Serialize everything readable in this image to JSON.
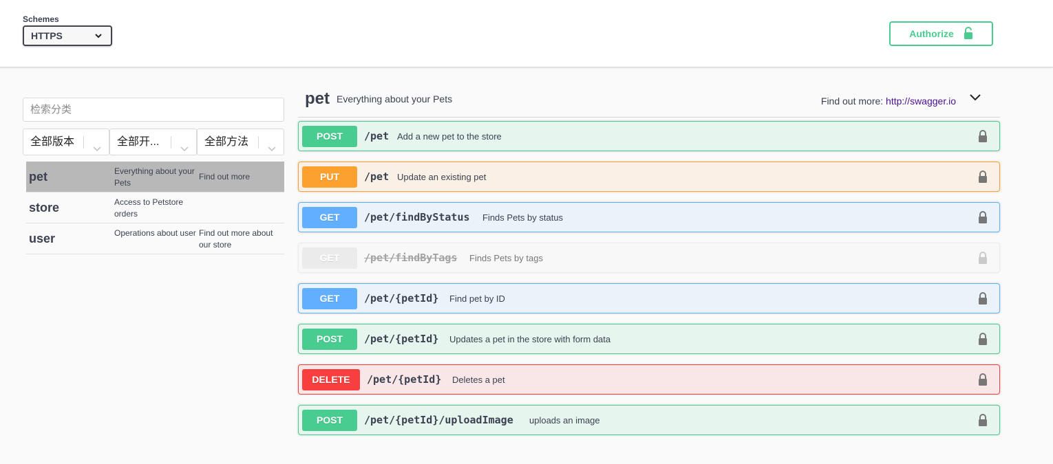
{
  "topbar": {
    "schemes_label": "Schemes",
    "scheme_value": "HTTPS",
    "authorize_label": "Authorize"
  },
  "sidebar": {
    "search_placeholder": "检索分类",
    "filters": [
      {
        "label": "全部版本"
      },
      {
        "label": "全部开..."
      },
      {
        "label": "全部方法"
      }
    ],
    "tags": [
      {
        "name": "pet",
        "description": "Everything about your Pets",
        "more": "Find out more",
        "active": true
      },
      {
        "name": "store",
        "description": "Access to Petstore orders",
        "more": "",
        "active": false
      },
      {
        "name": "user",
        "description": "Operations about user",
        "more": "Find out more about our store",
        "active": false
      }
    ]
  },
  "section": {
    "title": "pet",
    "description": "Everything about your Pets",
    "more_label": "Find out more:",
    "more_link": "http://swagger.io"
  },
  "operations": [
    {
      "method": "POST",
      "path": "/pet",
      "summary": "Add a new pet to the store"
    },
    {
      "method": "PUT",
      "path": "/pet",
      "summary": "Update an existing pet"
    },
    {
      "method": "GET",
      "path": "/pet/findByStatus",
      "summary": "Finds Pets by status"
    },
    {
      "method": "GET",
      "path": "/pet/findByTags",
      "summary": "Finds Pets by tags",
      "deprecated": true
    },
    {
      "method": "GET",
      "path": "/pet/{petId}",
      "summary": "Find pet by ID"
    },
    {
      "method": "POST",
      "path": "/pet/{petId}",
      "summary": "Updates a pet in the store with form data"
    },
    {
      "method": "DELETE",
      "path": "/pet/{petId}",
      "summary": "Deletes a pet"
    },
    {
      "method": "POST",
      "path": "/pet/{petId}/uploadImage",
      "summary": "uploads an image"
    }
  ],
  "colors": {
    "post": "#49cc90",
    "put": "#fca130",
    "get": "#61affe",
    "delete": "#f93e3e",
    "deprecated": "#ebebeb",
    "link": "#4a0f8c"
  },
  "icons": {
    "scheme_dropdown": "chevron-down-icon",
    "authorize": "unlock-icon",
    "filter_dropdown": "chevron-down-icon",
    "section_toggle": "chevron-down-icon",
    "operation_lock": "lock-icon"
  }
}
